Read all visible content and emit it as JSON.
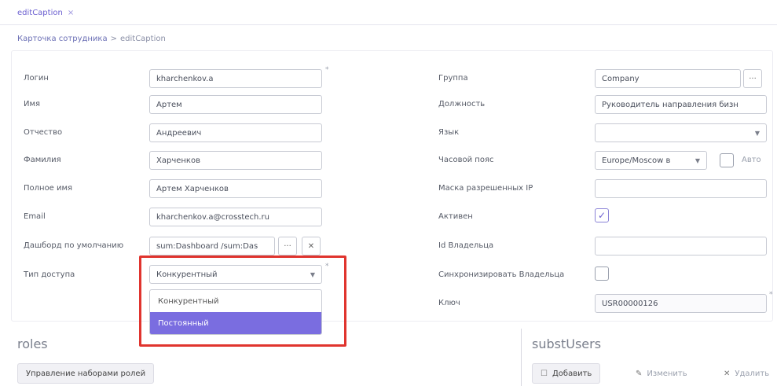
{
  "tab": {
    "label": "editCaption",
    "close": "×"
  },
  "breadcrumb": {
    "parent": "Карточка сотрудника",
    "separator": ">",
    "current": "editCaption"
  },
  "form": {
    "left": {
      "login": {
        "label": "Логин",
        "value": "kharchenkov.a"
      },
      "first_name": {
        "label": "Имя",
        "value": "Артем"
      },
      "middle_name": {
        "label": "Отчество",
        "value": "Андреевич"
      },
      "last_name": {
        "label": "Фамилия",
        "value": "Харченков"
      },
      "full_name": {
        "label": "Полное имя",
        "value": "Артем Харченков"
      },
      "email": {
        "label": "Email",
        "value": "kharchenkov.a@crosstech.ru"
      },
      "dashboard": {
        "label": "Дашборд по умолчанию",
        "value": "sum:Dashboard /sum:Das"
      },
      "access_type": {
        "label": "Тип доступа",
        "value": "Конкурентный",
        "options": [
          "Конкурентный",
          "Постоянный"
        ],
        "highlighted_option": "Постоянный"
      }
    },
    "right": {
      "group": {
        "label": "Группа",
        "value": "Company"
      },
      "position": {
        "label": "Должность",
        "value": "Руководитель направления бизн"
      },
      "language": {
        "label": "Язык",
        "value": ""
      },
      "timezone": {
        "label": "Часовой пояс",
        "value": "Europe/Moscow в",
        "auto_label": "Авто"
      },
      "ip_mask": {
        "label": "Маска разрешенных IP",
        "value": ""
      },
      "active": {
        "label": "Активен",
        "checked": true
      },
      "owner_id": {
        "label": "Id Владельца",
        "value": ""
      },
      "sync_owner": {
        "label": "Синхронизировать Владельца",
        "checked": false
      },
      "key": {
        "label": "Ключ",
        "value": "USR00000126"
      }
    },
    "required_mark": "*"
  },
  "roles": {
    "title": "roles",
    "manage_button": "Управление наборами ролей"
  },
  "substitutes": {
    "title": "substUsers",
    "add_button": "Добавить",
    "edit_button": "Изменить",
    "delete_button": "Удалить"
  },
  "icons": {
    "dropdown": "chevron-down-icon",
    "lookup": "ellipsis-icon",
    "clear": "close-icon",
    "check": "check-icon",
    "add": "add-icon",
    "edit": "pencil-icon",
    "delete": "close-icon"
  },
  "colors": {
    "accent": "#7a6de0",
    "highlight": "#e0342e"
  }
}
